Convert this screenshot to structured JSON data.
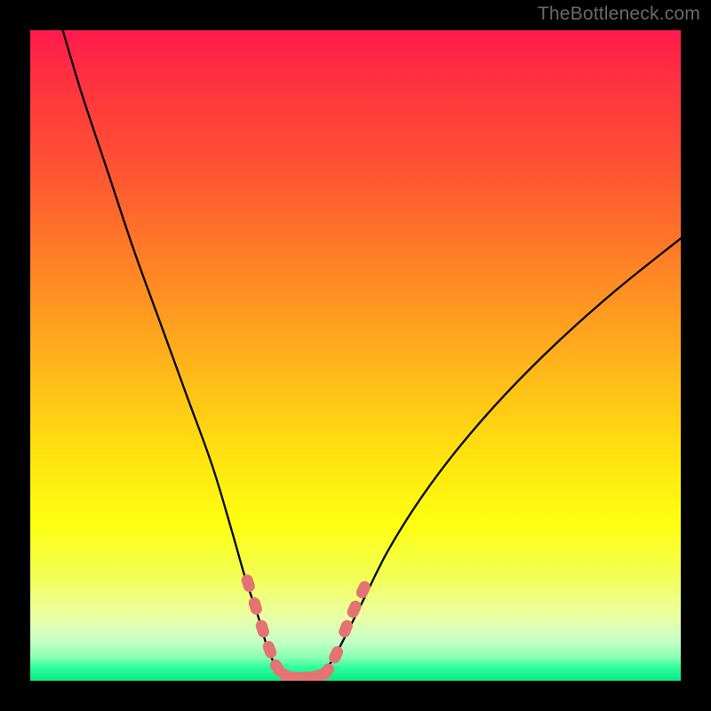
{
  "watermark": "TheBottleneck.com",
  "colors": {
    "frame": "#000000",
    "line": "#000000",
    "marker": "#e57373"
  },
  "chart_data": {
    "type": "line",
    "title": "",
    "xlabel": "",
    "ylabel": "",
    "xlim": [
      0,
      100
    ],
    "ylim": [
      0,
      100
    ],
    "grid": false,
    "legend": false,
    "series": [
      {
        "name": "bottleneck-curve",
        "x": [
          5,
          8,
          12,
          16,
          20,
          24,
          28,
          31,
          33,
          35,
          36.5,
          38,
          40,
          42,
          44,
          46,
          48,
          51,
          55,
          60,
          66,
          73,
          81,
          90,
          100
        ],
        "y": [
          100,
          90,
          78,
          66,
          55,
          44,
          33,
          23,
          16,
          10,
          5,
          2,
          0.5,
          0.5,
          0.7,
          2.5,
          6,
          12,
          20,
          28,
          36,
          44,
          52,
          60,
          68
        ]
      }
    ],
    "markers": [
      {
        "x": 33.5,
        "y": 15.0
      },
      {
        "x": 34.6,
        "y": 11.5
      },
      {
        "x": 35.7,
        "y": 8.0
      },
      {
        "x": 36.8,
        "y": 4.8
      },
      {
        "x": 38.0,
        "y": 2.0
      },
      {
        "x": 39.5,
        "y": 0.7
      },
      {
        "x": 41.0,
        "y": 0.5
      },
      {
        "x": 42.5,
        "y": 0.5
      },
      {
        "x": 44.0,
        "y": 0.7
      },
      {
        "x": 45.5,
        "y": 1.4
      },
      {
        "x": 47.0,
        "y": 4.0
      },
      {
        "x": 48.5,
        "y": 8.0
      },
      {
        "x": 49.8,
        "y": 11.0
      },
      {
        "x": 51.2,
        "y": 14.0
      }
    ],
    "annotations": []
  }
}
